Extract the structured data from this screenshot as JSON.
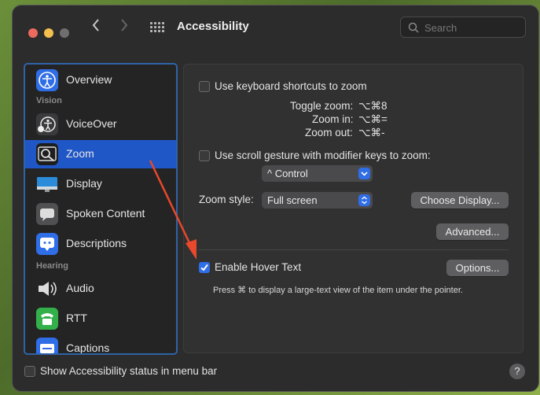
{
  "window": {
    "title": "Accessibility",
    "search_placeholder": "Search",
    "traffic_colors": [
      "#ed6a5e",
      "#f4bf4f",
      "#6f6f70"
    ]
  },
  "sidebar": {
    "sections": [
      "Vision",
      "Hearing"
    ],
    "items": [
      {
        "label": "Overview",
        "icon": "accessibility-person-icon",
        "color": "#2f6ee6"
      },
      {
        "label": "VoiceOver",
        "icon": "voiceover-icon",
        "color": "#444"
      },
      {
        "label": "Zoom",
        "icon": "zoom-magnifier-icon",
        "color": "#333",
        "selected": true
      },
      {
        "label": "Display",
        "icon": "display-monitor-icon",
        "color": "#2c8bd8"
      },
      {
        "label": "Spoken Content",
        "icon": "speech-bubble-icon",
        "color": "#555"
      },
      {
        "label": "Descriptions",
        "icon": "descriptions-bubble-icon",
        "color": "#2f6ee6"
      },
      {
        "label": "Audio",
        "icon": "speaker-icon",
        "color": "#555"
      },
      {
        "label": "RTT",
        "icon": "rtt-phone-icon",
        "color": "#34b04a"
      },
      {
        "label": "Captions",
        "icon": "captions-icon",
        "color": "#2f6ee6"
      }
    ]
  },
  "zoom": {
    "keyboard_shortcuts": {
      "label": "Use keyboard shortcuts to zoom",
      "checked": false
    },
    "shortcuts": [
      {
        "name": "Toggle zoom:",
        "keys": "⌥⌘8"
      },
      {
        "name": "Zoom in:",
        "keys": "⌥⌘="
      },
      {
        "name": "Zoom out:",
        "keys": "⌥⌘-"
      }
    ],
    "scroll_gesture": {
      "label": "Use scroll gesture with modifier keys to zoom:",
      "checked": false
    },
    "modifier_value": "^ Control",
    "zoom_style_label": "Zoom style:",
    "zoom_style_value": "Full screen",
    "choose_display": "Choose Display...",
    "advanced": "Advanced...",
    "hover_text": {
      "label": "Enable Hover Text",
      "checked": true
    },
    "options": "Options...",
    "hover_hint": "Press ⌘ to display a large-text view of the item under the pointer."
  },
  "footer": {
    "status_label": "Show Accessibility status in menu bar",
    "status_checked": false,
    "help": "?"
  }
}
